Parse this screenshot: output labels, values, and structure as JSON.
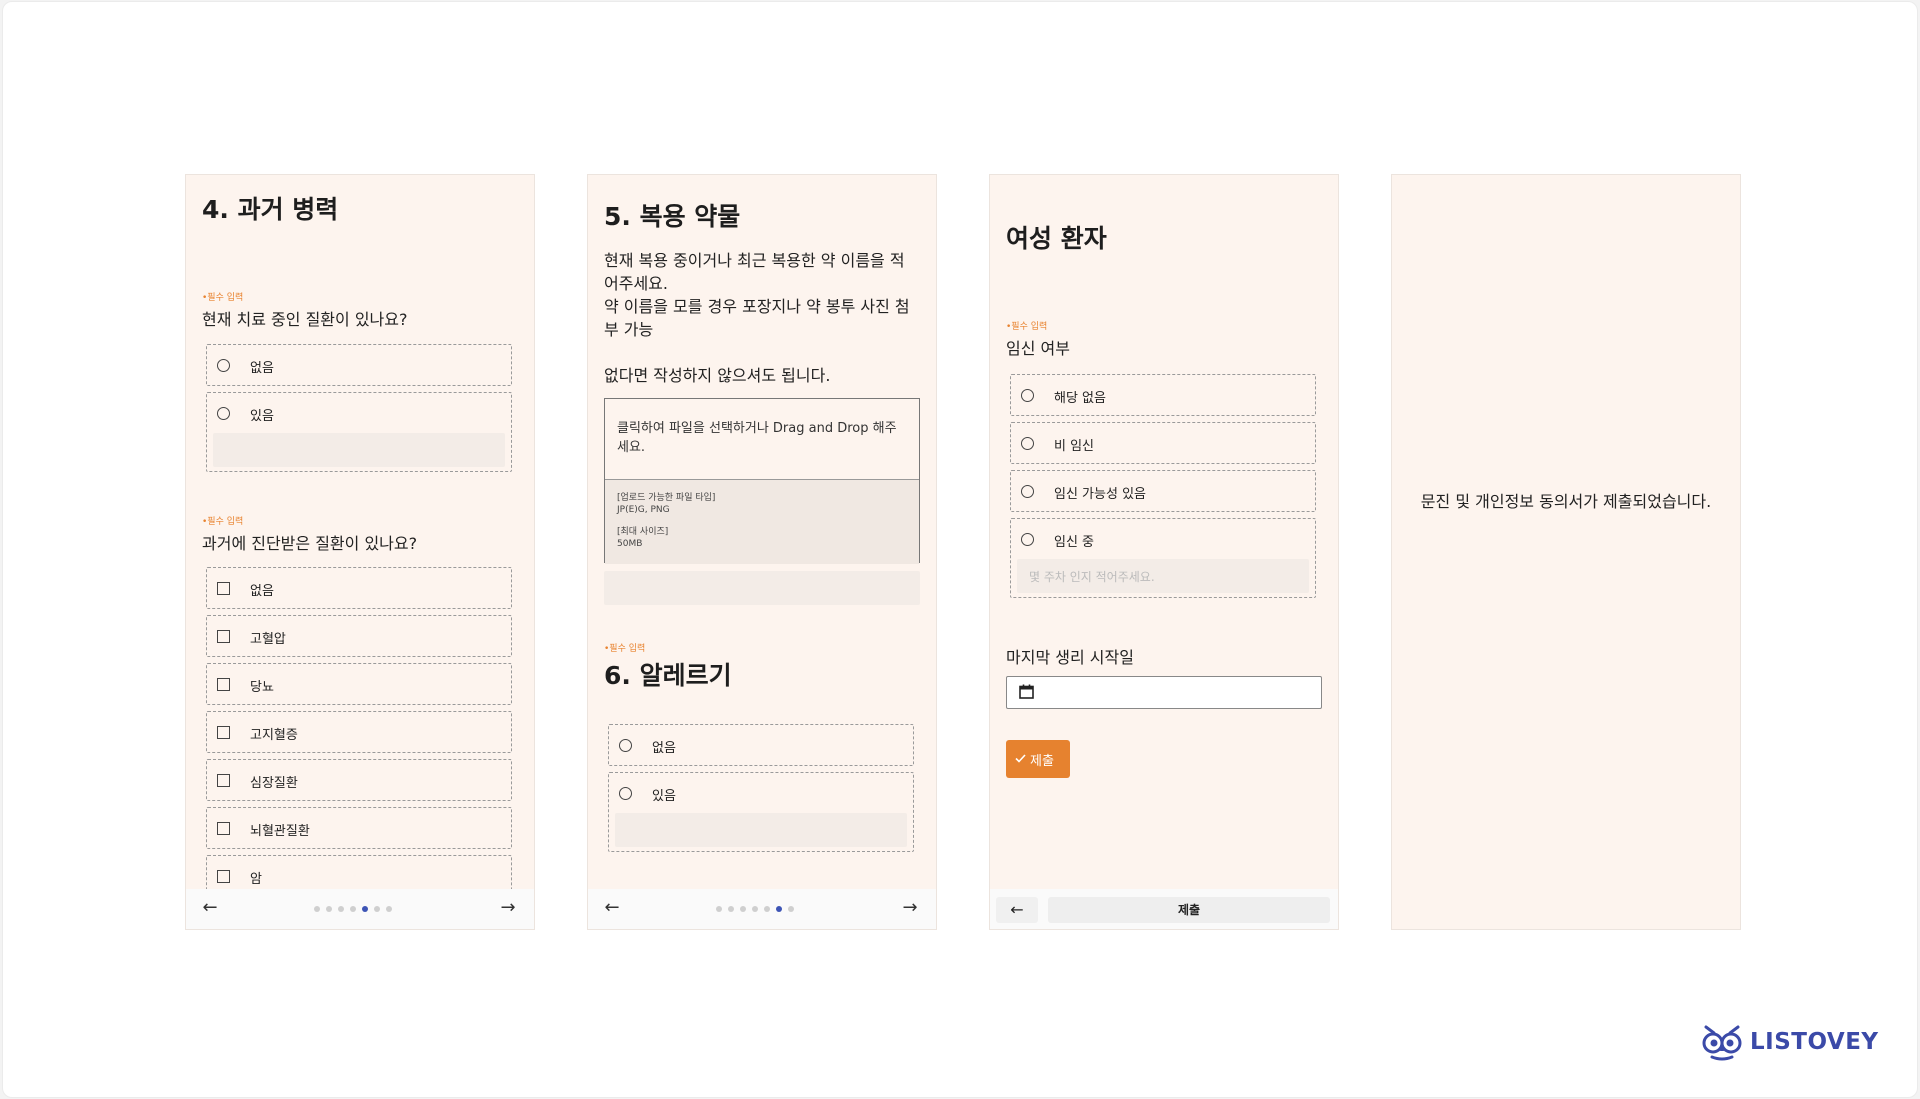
{
  "screen1": {
    "title": "4. 과거 병력",
    "q1": {
      "required": "•필수 입력",
      "question": "현재 치료 중인 질환이 있나요?",
      "options": [
        "없음",
        "있음"
      ]
    },
    "q2": {
      "required": "•필수 입력",
      "question": "과거에 진단받은 질환이 있나요?",
      "options": [
        "없음",
        "고혈압",
        "당뇨",
        "고지혈증",
        "심장질환",
        "뇌혈관질환",
        "암"
      ]
    },
    "nav": {
      "back": "←",
      "next": "→",
      "page_count": 7,
      "active_index": 4
    }
  },
  "screen2": {
    "title": "5.  복용 약물",
    "description": [
      "현재 복용 중이거나 최근 복용한 약 이름을 적",
      "어주세요.",
      "약 이름을 모를 경우 포장지나 약 봉투 사진 첨",
      "부 가능"
    ],
    "note": "없다면 작성하지 않으셔도 됩니다.",
    "upload": {
      "prompt": "클릭하여 파일을 선택하거나 Drag and Drop 해주세요.",
      "types_label": "[업로드 가능한 파일 타입]",
      "types_value": "JP(E)G, PNG",
      "size_label": "[최대 사이즈]",
      "size_value": "50MB"
    },
    "allergy": {
      "required": "•필수 입력",
      "title": "6. 알레르기",
      "options": [
        "없음",
        "있음"
      ]
    },
    "nav": {
      "back": "←",
      "next": "→",
      "page_count": 7,
      "active_index": 5
    }
  },
  "screen3": {
    "title": "여성 환자",
    "pregnancy": {
      "required": "•필수 입력",
      "question": "임신 여부",
      "options": [
        "해당 없음",
        "비 임신",
        "임신 가능성 있음",
        "임신 중"
      ],
      "weeks_placeholder": "몇 주차 인지 적어주세요."
    },
    "last_period": {
      "label": "마지막 생리 시작일",
      "value": ""
    },
    "submit_label": "제출",
    "bottom": {
      "back": "←",
      "submit": "제출"
    }
  },
  "screen4": {
    "message": "문진 및 개인정보 동의서가 제출되었습니다."
  },
  "brand": {
    "name": "LISTOVEY",
    "color": "#3b4aa8",
    "accent": "#e6822f"
  }
}
